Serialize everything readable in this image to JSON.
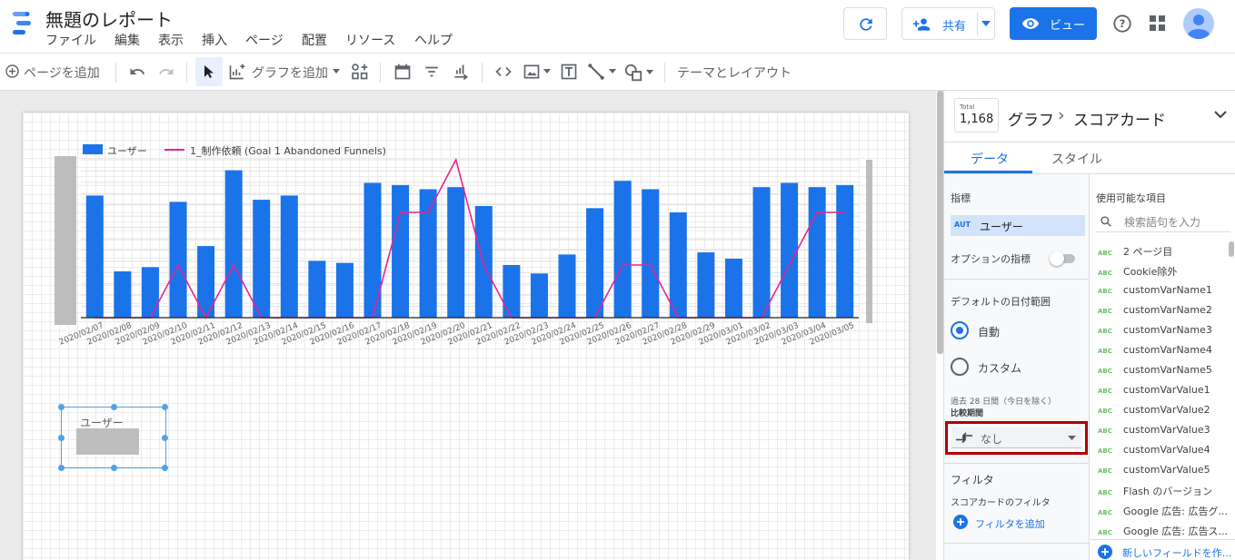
{
  "header": {
    "title": "無題のレポート",
    "menu": [
      "ファイル",
      "編集",
      "表示",
      "挿入",
      "ページ",
      "配置",
      "リソース",
      "ヘルプ"
    ],
    "share_label": "共有",
    "view_label": "ビュー"
  },
  "toolbar": {
    "add_page": "ページを追加",
    "add_chart": "グラフを追加",
    "theme_layout": "テーマとレイアウト"
  },
  "chart": {
    "legend_bar": "ユーザー",
    "legend_line": "1_制作依頼 (Goal 1 Abandoned Funnels)"
  },
  "scorecard": {
    "label": "ユーザー"
  },
  "panel": {
    "total_label": "Total",
    "total_value": "1,168",
    "breadcrumb_1": "グラフ",
    "breadcrumb_sep": "›",
    "breadcrumb_2": "スコアカード",
    "tab_data": "データ",
    "tab_style": "スタイル",
    "metric_heading": "指標",
    "metric_type": "AUT",
    "metric_name": "ユーザー",
    "optional_metrics": "オプションの指標",
    "date_range_heading": "デフォルトの日付範囲",
    "radio_auto": "自動",
    "radio_custom": "カスタム",
    "date_range_hint": "過去 28 日間（今日を除く）",
    "comparison_label": "比較期間",
    "comparison_value": "なし",
    "filter_heading": "フィルタ",
    "scorecard_filter": "スコアカードのフィルタ",
    "add_filter": "フィルタを追加",
    "available_fields": "使用可能な項目",
    "search_placeholder": "検索語句を入力",
    "new_field": "新しいフィールドを作...",
    "fields": [
      "2 ページ目",
      "Cookie除外",
      "customVarName1",
      "customVarName2",
      "customVarName3",
      "customVarName4",
      "customVarName5",
      "customVarValue1",
      "customVarValue2",
      "customVarValue3",
      "customVarValue4",
      "customVarValue5",
      "Flash のバージョン",
      "Google 広告: 広告グ...",
      "Google 広告: 広告ス..."
    ],
    "field_type": "ABC"
  },
  "colors": {
    "bar": "#1a73e8",
    "line": "#e52592",
    "accent": "#1a73e8",
    "highlight_border": "#b00000"
  },
  "chart_data": {
    "type": "bar",
    "categories": [
      "2020/02/07",
      "2020/02/08",
      "2020/02/09",
      "2020/02/10",
      "2020/02/11",
      "2020/02/12",
      "2020/02/13",
      "2020/02/14",
      "2020/02/15",
      "2020/02/16",
      "2020/02/17",
      "2020/02/18",
      "2020/02/19",
      "2020/02/20",
      "2020/02/21",
      "2020/02/22",
      "2020/02/23",
      "2020/02/24",
      "2020/02/25",
      "2020/02/26",
      "2020/02/27",
      "2020/02/28",
      "2020/02/29",
      "2020/03/01",
      "2020/03/02",
      "2020/03/03",
      "2020/03/04",
      "2020/03/05"
    ],
    "series": [
      {
        "name": "ユーザー",
        "type": "bar",
        "values": [
          58,
          22,
          24,
          55,
          34,
          70,
          56,
          58,
          27,
          26,
          64,
          63,
          61,
          62,
          53,
          25,
          21,
          30,
          52,
          65,
          61,
          50,
          31,
          28,
          62,
          64,
          62,
          63
        ]
      },
      {
        "name": "1_制作依頼 (Goal 1 Abandoned Funnels)",
        "type": "line",
        "values": [
          0,
          0,
          0,
          1,
          0,
          1,
          0,
          0,
          0,
          0,
          0,
          2,
          2,
          3,
          1,
          0,
          0,
          0,
          0,
          1,
          1,
          0,
          0,
          0,
          0,
          1,
          2,
          2
        ]
      }
    ],
    "grid": true,
    "legend": "top-left"
  }
}
